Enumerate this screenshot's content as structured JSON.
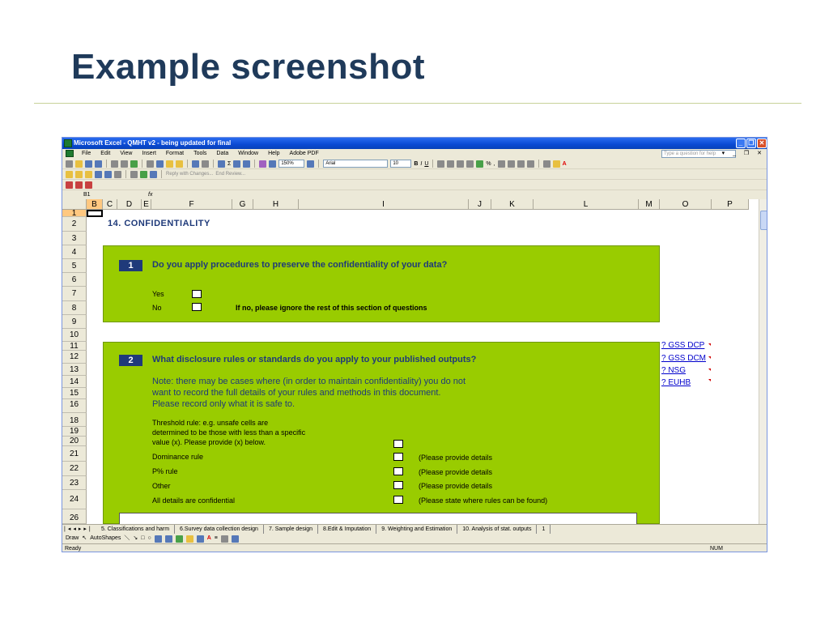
{
  "slide": {
    "title": "Example screenshot"
  },
  "window": {
    "title": "Microsoft Excel - QMHT v2 - being updated for final"
  },
  "menu": {
    "items": [
      "File",
      "Edit",
      "View",
      "Insert",
      "Format",
      "Tools",
      "Data",
      "Window",
      "Help",
      "Adobe PDF"
    ],
    "help_placeholder": "Type a question for help"
  },
  "toolbar": {
    "zoom": "150%",
    "font": "Arial",
    "size": "10",
    "bold": "B",
    "italic": "I",
    "underline": "U",
    "percent": "%",
    "comma": ",",
    "reply_changes": "Reply with Changes...",
    "end_review": "End Review..."
  },
  "formula_bar": {
    "name_box": "B1",
    "fx": "fx"
  },
  "columns": [
    "B",
    "C",
    "D",
    "E",
    "F",
    "G",
    "H",
    "I",
    "J",
    "K",
    "L",
    "M",
    "O",
    "P"
  ],
  "rows": [
    "1",
    "2",
    "3",
    "4",
    "5",
    "6",
    "7",
    "8",
    "9",
    "10",
    "11",
    "12",
    "13",
    "14",
    "15",
    "16",
    "18",
    "19",
    "20",
    "21",
    "22",
    "23",
    "24",
    "26"
  ],
  "sheet": {
    "section_title": "14.  CONFIDENTIALITY",
    "q1": {
      "number": "1",
      "question": "Do you apply procedures to preserve the confidentiality of your data?",
      "yes": "Yes",
      "no": "No",
      "no_note": "If no, please ignore the rest of this section of questions"
    },
    "q2": {
      "number": "2",
      "question": "What disclosure rules or standards do you apply to your published outputs?",
      "note1": "Note: there may be cases where (in order to maintain confidentiality) you do not",
      "note2": "want to record the full details of your rules and methods in this document.",
      "note3": "Please record only what it is safe to.",
      "threshold1": "Threshold rule: e.g. unsafe cells are",
      "threshold2": "determined to be those with less than a specific",
      "threshold3": "value (x).  Please provide (x) below.",
      "dominance": "Dominance rule",
      "p_rule": "P% rule",
      "other": "Other",
      "all_conf": "All details are confidential",
      "provide_details": "(Please provide details",
      "state_where": "(Please state where rules can be found)"
    },
    "links": [
      "? GSS DCP",
      "? GSS DCM",
      "? NSG",
      "? EUHB"
    ]
  },
  "tabs": [
    "5. Classifications and harm",
    "6.Survey data collection design",
    "7. Sample design",
    "8.Edit & Imputation",
    "9. Weighting and Estimation",
    "10. Analysis of stat. outputs",
    "1"
  ],
  "drawbar": {
    "draw": "Draw",
    "autoshapes": "AutoShapes"
  },
  "status": {
    "ready": "Ready",
    "num": "NUM"
  }
}
